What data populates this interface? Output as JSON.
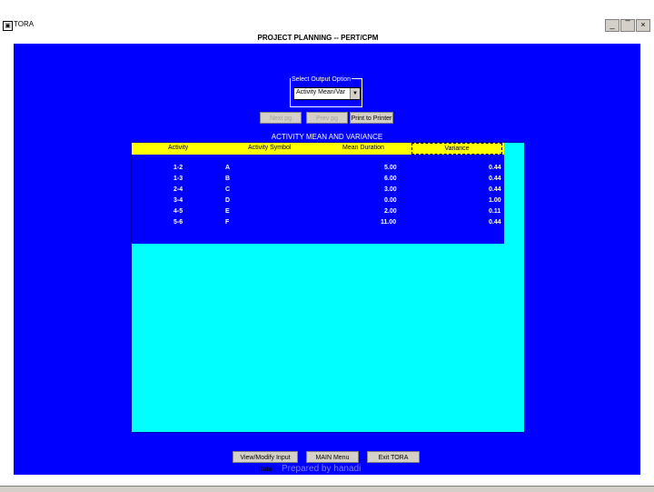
{
  "window": {
    "app_title": "TORA",
    "header_title": "PROJECT PLANNING -- PERT/CPM",
    "minimize": "_",
    "maximize": "̅",
    "close": "×",
    "app_icon": "▣"
  },
  "output_option": {
    "label": "Select Output Option",
    "selected": "Activity Mean/Var",
    "arrow": "▼"
  },
  "toolbar": {
    "btn1": "Next pg",
    "btn2": "Prev pg",
    "btn3": "Print to Printer"
  },
  "section_title": "ACTIVITY MEAN AND VARIANCE",
  "table": {
    "headers": [
      "Activity",
      "Activity Symbol",
      "Mean Duration",
      "Variance"
    ],
    "rows": [
      [
        "1-2",
        "A",
        "5.00",
        "0.44"
      ],
      [
        "1-3",
        "B",
        "6.00",
        "0.44"
      ],
      [
        "2-4",
        "C",
        "3.00",
        "0.44"
      ],
      [
        "3-4",
        "D",
        "0.00",
        "1.00"
      ],
      [
        "4-5",
        "E",
        "2.00",
        "0.11"
      ],
      [
        "5-6",
        "F",
        "11.00",
        "0.44"
      ]
    ]
  },
  "bottom_buttons": {
    "view_modify": "View/Modify Input Data",
    "main_menu": "MAIN Menu",
    "exit": "Exit TORA"
  },
  "watermark": "Prepared by hanadi"
}
